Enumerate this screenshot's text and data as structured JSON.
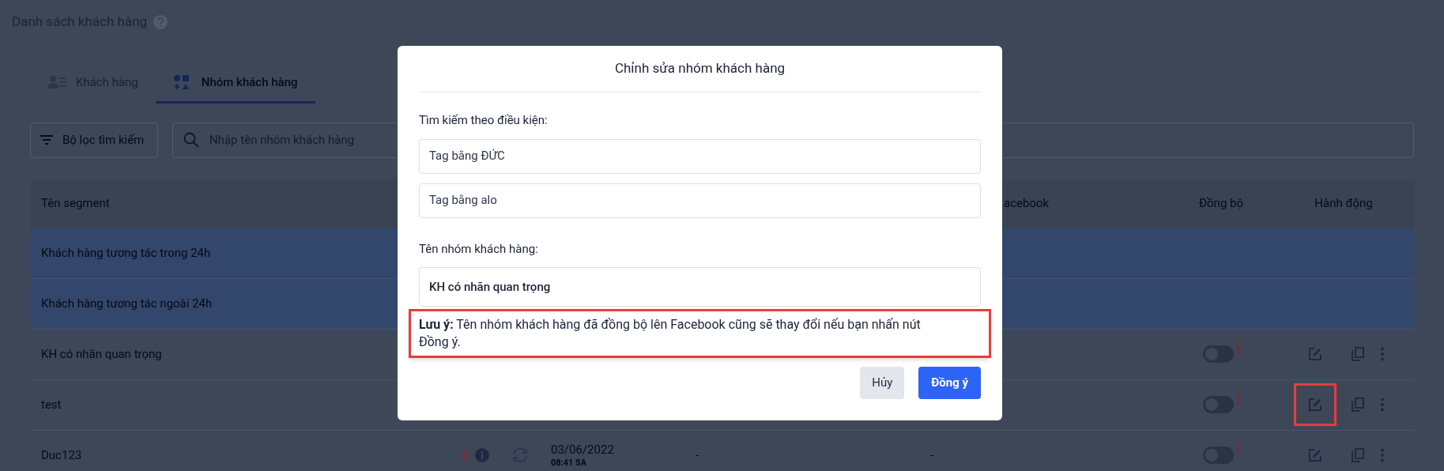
{
  "page": {
    "title": "Danh sách khách hàng"
  },
  "tabs": [
    {
      "label": "Khách hàng",
      "selected": false
    },
    {
      "label": "Nhóm khách hàng",
      "selected": true
    }
  ],
  "filter_button": "Bộ lọc tìm kiếm",
  "search": {
    "placeholder": "Nhập tên nhóm khách hàng"
  },
  "table": {
    "columns": [
      "Tên segment",
      "acebook",
      "Đồng bộ",
      "Hành động"
    ],
    "rows": [
      {
        "kind": "default",
        "name": "Khách hàng tương tác trong 24h",
        "highlighted": true
      },
      {
        "kind": "default",
        "name": "Khách hàng tương tác ngoài 24h",
        "highlighted": true
      },
      {
        "kind": "custom",
        "name": "KH có nhãn quan trọng",
        "highlighted": false,
        "synced": false,
        "edit_annotated": false
      },
      {
        "kind": "custom",
        "name": "test",
        "highlighted": false,
        "synced": false,
        "edit_annotated": true
      },
      {
        "kind": "custom",
        "name": "Duc123",
        "highlighted": false,
        "count": "0",
        "date": "03/06/2022",
        "time": "08:41 SA",
        "column_5": "-",
        "column_6": "-",
        "synced": false,
        "edit_annotated": false
      }
    ]
  },
  "modal": {
    "title": "Chỉnh sửa nhóm khách hàng",
    "conditions_label": "Tìm kiếm theo điều kiện:",
    "conditions": [
      "Tag bằng ĐỨC",
      "Tag bằng alo"
    ],
    "name_label": "Tên nhóm khách hàng:",
    "name_value": "KH có nhãn quan trọng",
    "note": "**Lưu ý:** Tên nhóm khách hàng đã đồng bộ lên Facebook cũng sẽ thay đổi nếu bạn nhấn nút Đồng ý.",
    "note_annotated": true,
    "buttons": [
      {
        "label": "Hủy",
        "kind": "secondary"
      },
      {
        "label": "Đồng ý",
        "kind": "primary"
      }
    ]
  }
}
